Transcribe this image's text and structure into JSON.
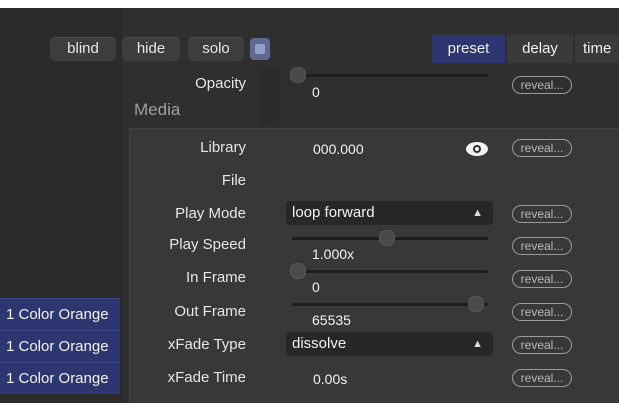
{
  "toolbar": {
    "blind": "blind",
    "hide": "hide",
    "solo": "solo",
    "tabs": [
      "preset",
      "delay",
      "time"
    ]
  },
  "opacity": {
    "label": "Opacity",
    "value": "0"
  },
  "media": {
    "title": "Media",
    "rows": [
      {
        "label": "Library",
        "value": "000.000"
      },
      {
        "label": "File",
        "value": ""
      },
      {
        "label": "Play Mode",
        "value": "loop forward"
      },
      {
        "label": "Play Speed",
        "value": "1.000x"
      },
      {
        "label": "In Frame",
        "value": "0"
      },
      {
        "label": "Out Frame",
        "value": "65535"
      },
      {
        "label": "xFade Type",
        "value": "dissolve"
      },
      {
        "label": "xFade Time",
        "value": "0.00s"
      }
    ]
  },
  "reveal_label": "reveal...",
  "sidebar": [
    "1 Color Orange",
    "1 Color Orange",
    "1 Color Orange"
  ],
  "colors": {
    "accent": "#2d3670",
    "background": "#2f2f2f",
    "panel": "#383838"
  }
}
